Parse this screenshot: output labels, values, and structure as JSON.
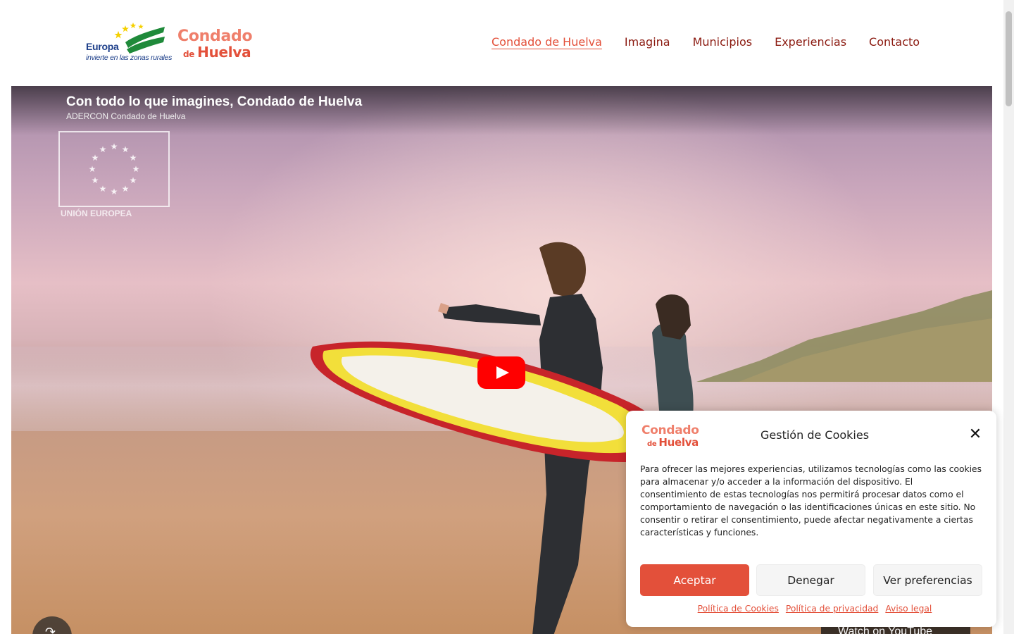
{
  "header": {
    "logo_europa": {
      "word": "Europa",
      "tagline": "invierte en las zonas rurales"
    },
    "logo_condado": {
      "line1": "Condado",
      "line2_small": "de",
      "line2": "Huelva"
    },
    "nav": [
      {
        "label": "Condado de Huelva",
        "active": true
      },
      {
        "label": "Imagina",
        "active": false
      },
      {
        "label": "Municipios",
        "active": false
      },
      {
        "label": "Experiencias",
        "active": false
      },
      {
        "label": "Contacto",
        "active": false
      }
    ]
  },
  "video": {
    "title": "Con todo lo que imagines, Condado de Huelva",
    "channel": "ADERCON Condado de Huelva",
    "eu_label": "UNIÓN EUROPEA",
    "watch_label": "Watch on YouTube"
  },
  "cookie_banner": {
    "title": "Gestión de Cookies",
    "text": "Para ofrecer las mejores experiencias, utilizamos tecnologías como las cookies para almacenar y/o acceder a la información del dispositivo. El consentimiento de estas tecnologías nos permitirá procesar datos como el comportamiento de navegación o las identificaciones únicas en este sitio. No consentir o retirar el consentimiento, puede afectar negativamente a ciertas características y funciones.",
    "buttons": {
      "accept": "Aceptar",
      "deny": "Denegar",
      "preferences": "Ver preferencias"
    },
    "links": {
      "cookies_policy": "Política de Cookies",
      "privacy_policy": "Política de privacidad",
      "legal": "Aviso legal"
    }
  },
  "colors": {
    "brand_red": "#e3503a",
    "brand_coral": "#ef7f6b",
    "nav_text": "#8b1a10",
    "europa_blue": "#1d3f8a",
    "europa_green": "#1f8a3a",
    "youtube_red": "#ff0000"
  }
}
